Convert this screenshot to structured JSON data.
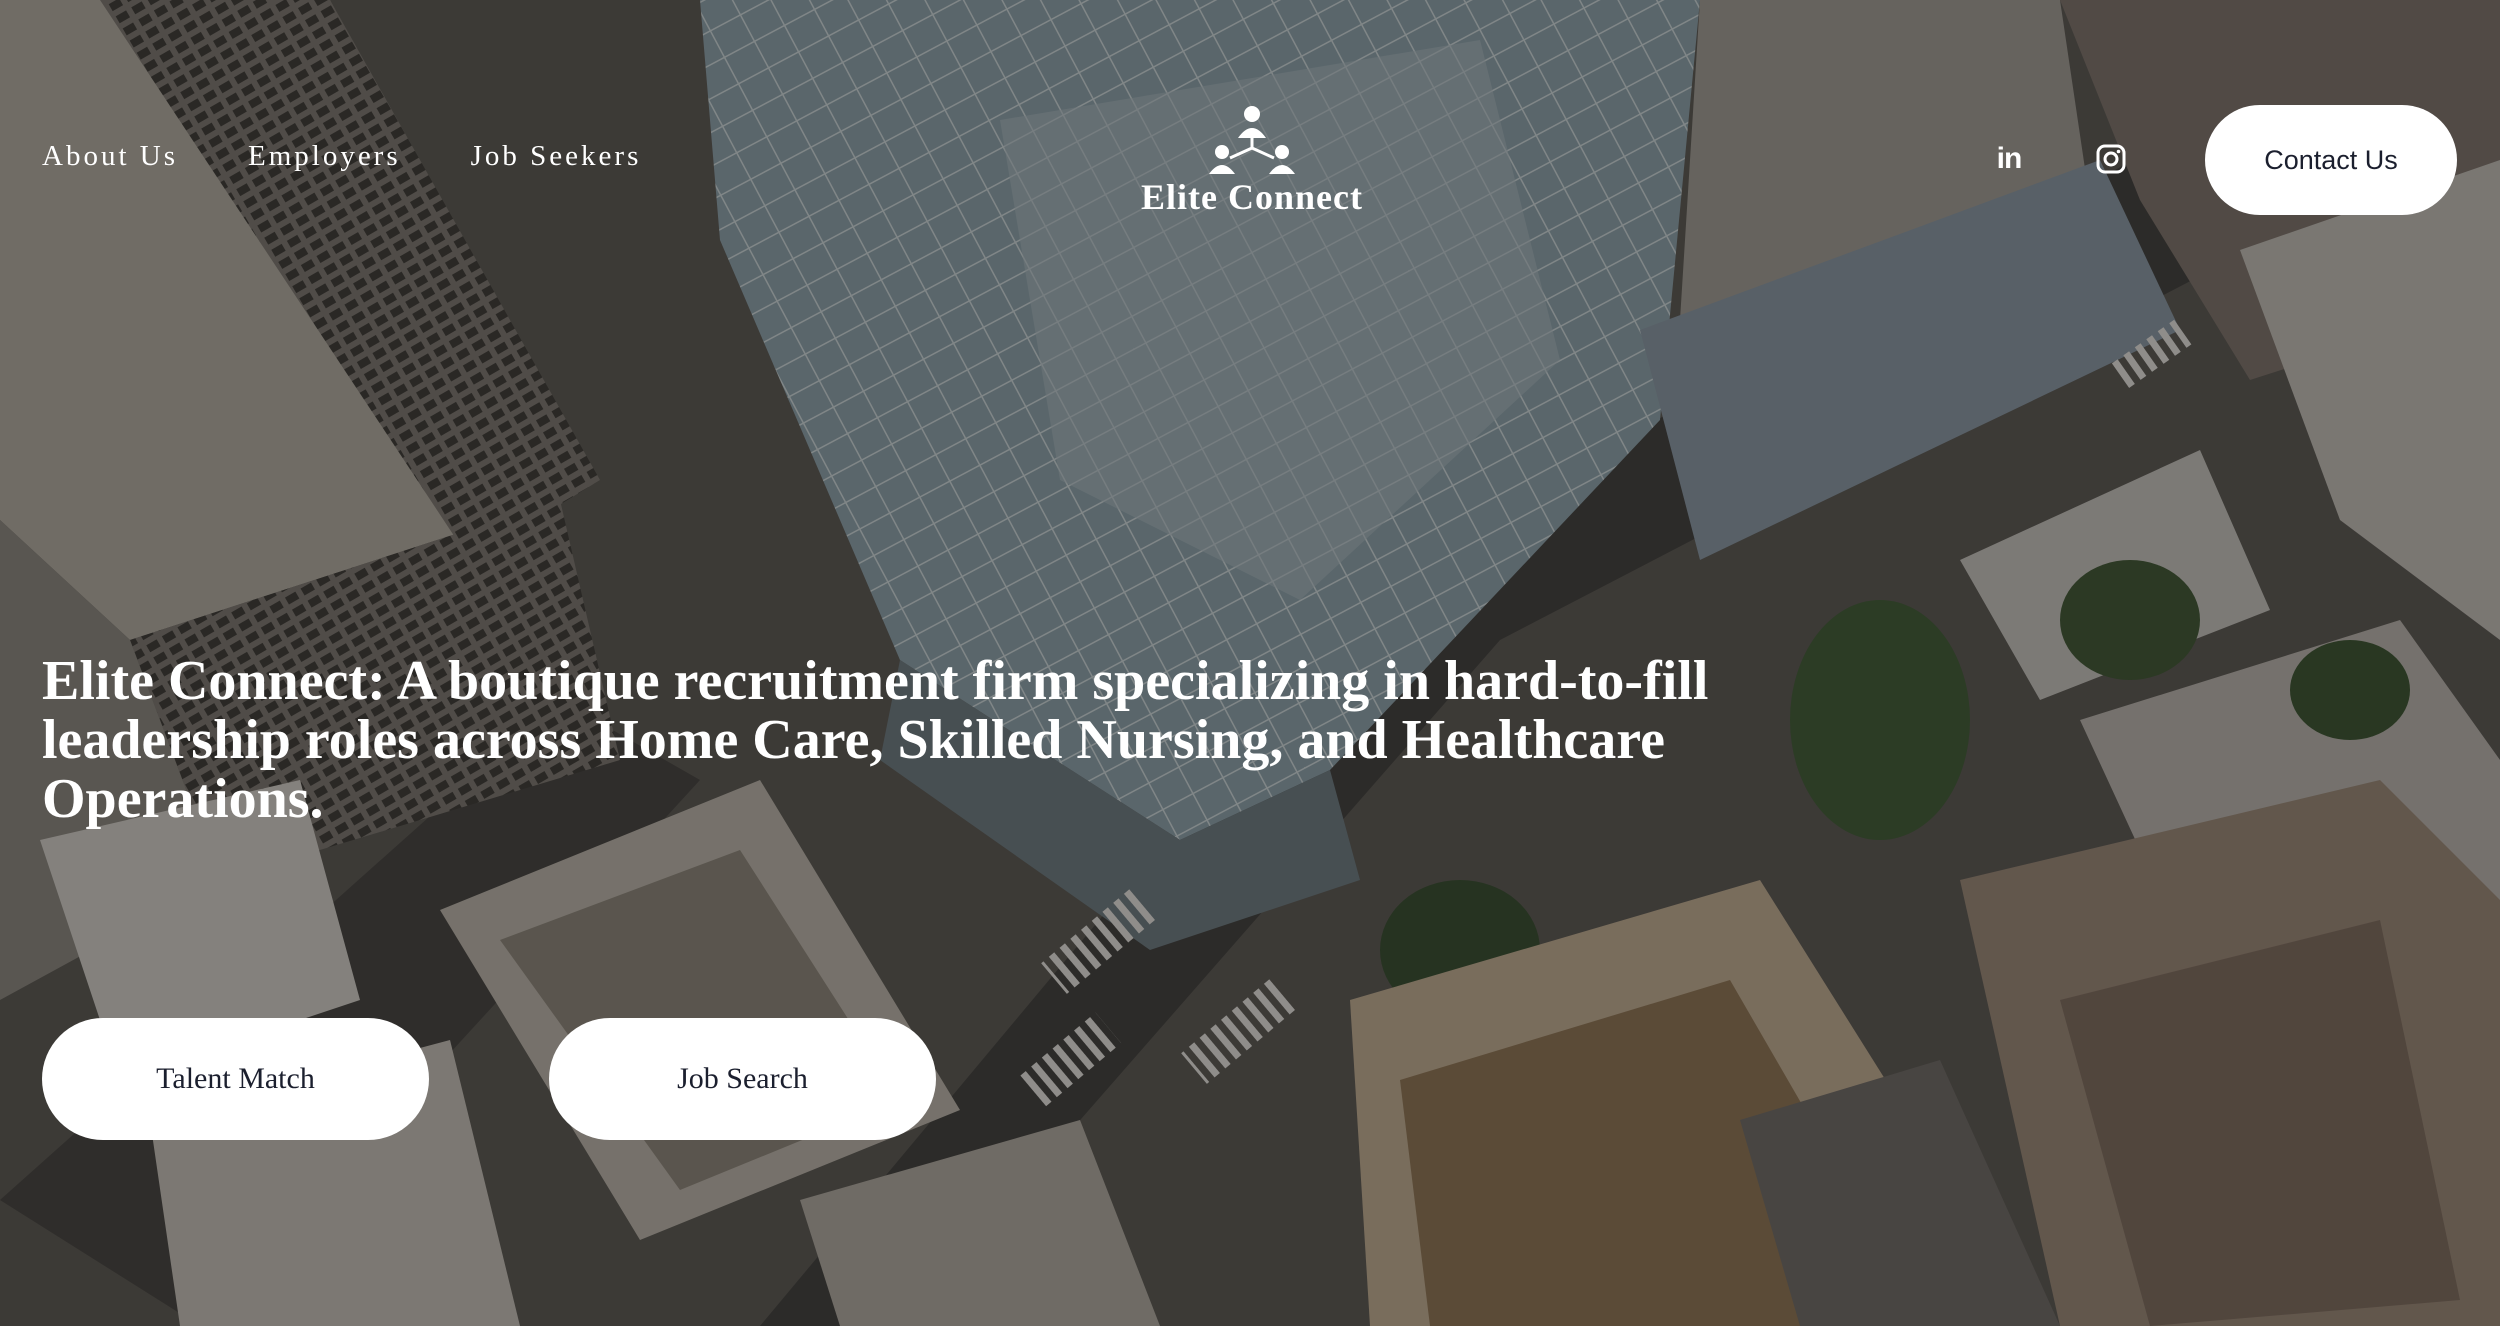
{
  "nav": {
    "items": [
      {
        "label": "About Us"
      },
      {
        "label": "Employers"
      },
      {
        "label": "Job Seekers"
      }
    ]
  },
  "logo": {
    "text": "Elite Connect",
    "icon": "three-people-network-icon"
  },
  "social": {
    "linkedin_icon": "linkedin-icon",
    "linkedin_text": "in",
    "instagram_icon": "instagram-icon"
  },
  "header": {
    "contact_label": "Contact Us"
  },
  "hero": {
    "headline": "Elite Connect: A boutique recruitment firm specializing in hard-to-fill leadership roles across Home Care, Skilled Nursing, and Healthcare Operations.",
    "background": "aerial-city-skyscrapers-image",
    "buttons": [
      {
        "label": "Talent Match"
      },
      {
        "label": "Job Search"
      }
    ]
  },
  "colors": {
    "text": "#ffffff",
    "button_bg": "#ffffff",
    "button_text": "#1b1f2e",
    "overlay": "rgba(20,18,16,0.42)"
  }
}
